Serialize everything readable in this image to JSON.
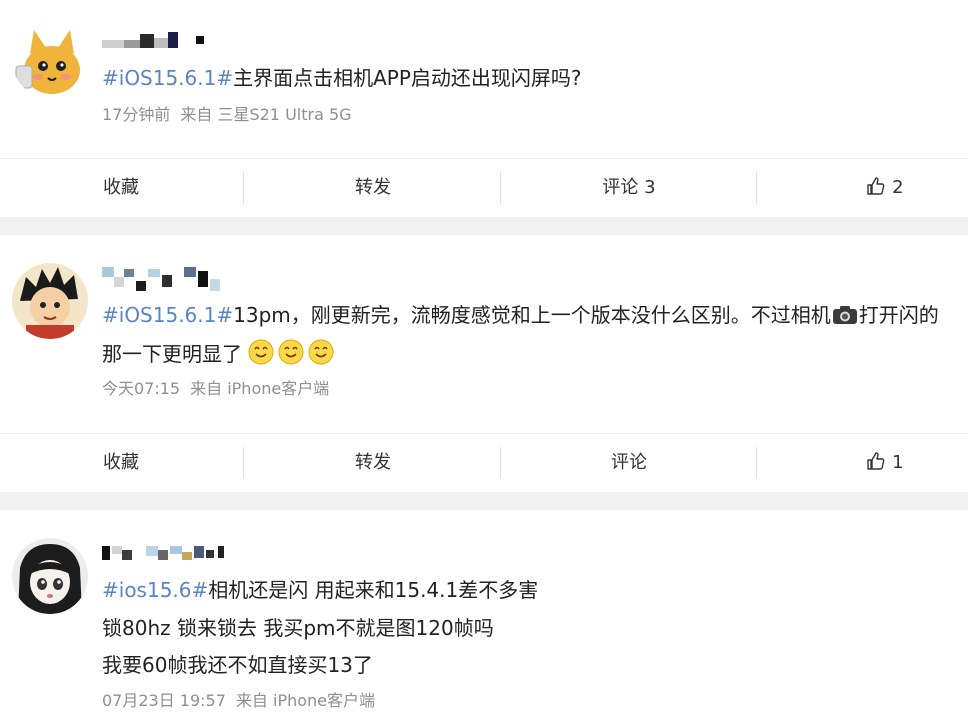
{
  "posts": [
    {
      "text_lines": [
        {
          "tag": "#iOS15.6.1#",
          "text": "主界面点击相机APP启动还出现闪屏吗?"
        }
      ],
      "time": "17分钟前",
      "source": "来自 三星S21 Ultra 5G",
      "actions": {
        "collect": "收藏",
        "repost": "转发",
        "comment": "评论 3",
        "like_count": "2"
      }
    },
    {
      "text_lines": [
        {
          "tag": "#iOS15.6.1#",
          "text": "13pm，刚更新完，流畅度感觉和上一个版本没什么区别。不过相机",
          "text2": "打开闪的"
        },
        {
          "text": "那一下更明显了"
        }
      ],
      "time": "今天07:15",
      "source": "来自 iPhone客户端",
      "actions": {
        "collect": "收藏",
        "repost": "转发",
        "comment": "评论",
        "like_count": "1"
      }
    },
    {
      "text_lines": [
        {
          "tag": "#ios15.6#",
          "text": "相机还是闪 用起来和15.4.1差不多害"
        },
        {
          "text": "锁80hz 锁来锁去 我买pm不就是图120帧吗"
        },
        {
          "text": "我要60帧我还不如直接买13了"
        }
      ],
      "time": "07月23日 19:57",
      "source": "来自 iPhone客户端"
    }
  ],
  "icons": {
    "like": "thumbs-up-icon",
    "emoji": "smile-emoji-icon",
    "camera": "camera-emoji-icon"
  },
  "colors": {
    "tag": "#5a85c4",
    "meta": "#8f8f8f",
    "separator": "#f2f2f2"
  }
}
